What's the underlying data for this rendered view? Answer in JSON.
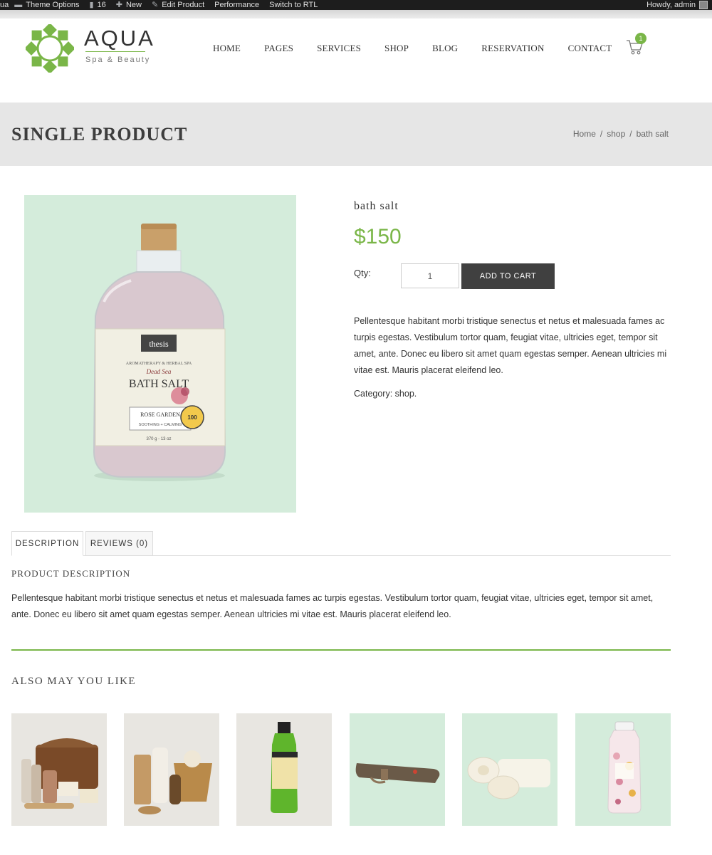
{
  "admin_bar": {
    "site": "ua",
    "theme_options": "Theme Options",
    "comments": "16",
    "new": "New",
    "edit": "Edit Product",
    "performance": "Performance",
    "rtl": "Switch to RTL",
    "howdy": "Howdy, admin"
  },
  "logo": {
    "title": "AQUA",
    "subtitle": "Spa & Beauty"
  },
  "nav": [
    "HOME",
    "PAGES",
    "SERVICES",
    "SHOP",
    "BLOG",
    "RESERVATION",
    "CONTACT"
  ],
  "cart": {
    "count": "1"
  },
  "page_title": "SINGLE PRODUCT",
  "breadcrumb": [
    "Home",
    "/",
    "shop",
    "/",
    "bath salt"
  ],
  "product": {
    "name": "bath salt",
    "price": "$150",
    "qty_label": "Qty:",
    "qty_value": "1",
    "add_to_cart": "ADD TO CART",
    "description": "Pellentesque habitant morbi tristique senectus et netus et malesuada fames ac turpis egestas. Vestibulum tortor quam, feugiat vitae, ultricies eget, tempor sit amet, ante. Donec eu libero sit amet quam egestas semper. Aenean ultricies mi vitae est. Mauris placerat eleifend leo.",
    "category": "Category: shop.",
    "label": {
      "brand": "thesis",
      "line1": "AROMATHERAPY & HERBAL SPA",
      "line2": "Dead Sea",
      "line3": "BATH SALT",
      "line4": "ROSE GARDEN",
      "line5": "SOOTHING + CALMING",
      "line6": "370 g - 13 oz",
      "seal": "100"
    }
  },
  "tabs": {
    "description": "DESCRIPTION",
    "reviews": "REVIEWS (0)"
  },
  "product_description": {
    "title": "PRODUCT DESCRIPTION",
    "text": "Pellentesque habitant morbi tristique senectus et netus et malesuada fames ac turpis egestas. Vestibulum tortor quam, feugiat vitae, ultricies eget, tempor sit amet, ante. Donec eu libero sit amet quam egestas semper. Aenean ultricies mi vitae est. Mauris placerat eleifend leo."
  },
  "related": {
    "title": "ALSO MAY YOU LIKE",
    "items": [
      {
        "image": "wicker-basket-spa-set",
        "bg": "#e8e6e1"
      },
      {
        "image": "eco-spa-basket",
        "bg": "#e8e6e1"
      },
      {
        "image": "green-therapy-bottle",
        "bg": "#e8e6e1"
      },
      {
        "image": "leather-roll-kit",
        "bg": "#d4ecdb"
      },
      {
        "image": "soap-bars",
        "bg": "#d4ecdb"
      },
      {
        "image": "floral-bath-jar",
        "bg": "#d4ecdb"
      }
    ]
  },
  "colors": {
    "accent": "#7ab648",
    "button": "#404040",
    "title_band": "#e6e6e6",
    "admin_bar": "#1d1d1d"
  }
}
